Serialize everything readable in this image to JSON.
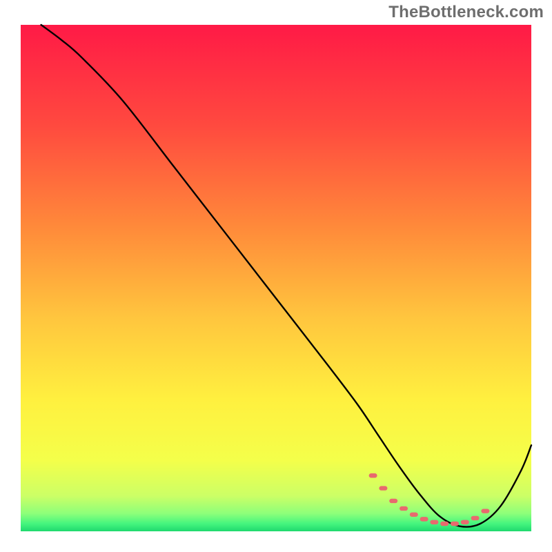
{
  "watermark": "TheBottleneck.com",
  "chart_data": {
    "type": "line",
    "title": "",
    "xlabel": "",
    "ylabel": "",
    "xlim": [
      0,
      100
    ],
    "ylim": [
      0,
      100
    ],
    "grid": false,
    "legend": false,
    "gradient_stops": [
      {
        "offset": 0.0,
        "color": "#ff1a46"
      },
      {
        "offset": 0.2,
        "color": "#ff4a3f"
      },
      {
        "offset": 0.4,
        "color": "#ff8a3a"
      },
      {
        "offset": 0.58,
        "color": "#ffc63e"
      },
      {
        "offset": 0.74,
        "color": "#fff03f"
      },
      {
        "offset": 0.86,
        "color": "#f4ff4a"
      },
      {
        "offset": 0.93,
        "color": "#ccff66"
      },
      {
        "offset": 0.965,
        "color": "#8dff7a"
      },
      {
        "offset": 0.985,
        "color": "#45f57e"
      },
      {
        "offset": 1.0,
        "color": "#1fd96e"
      }
    ],
    "series": [
      {
        "name": "bottleneck-curve",
        "color": "#000000",
        "x": [
          4,
          8,
          12,
          20,
          30,
          40,
          50,
          60,
          66,
          70,
          74,
          78,
          82,
          86,
          90,
          94,
          98,
          100
        ],
        "values": [
          100,
          97,
          93.5,
          85,
          72,
          59,
          46,
          33,
          25,
          19,
          13,
          7.5,
          3,
          1,
          1.5,
          5,
          12,
          17
        ]
      },
      {
        "name": "optimal-zone-marker",
        "color": "#e86a6e",
        "style": "dotted",
        "x": [
          69,
          71,
          73,
          75,
          77,
          79,
          81,
          83,
          85,
          87,
          89,
          91
        ],
        "values": [
          11,
          8.5,
          6,
          4.5,
          3.3,
          2.4,
          1.8,
          1.5,
          1.5,
          1.8,
          2.6,
          4
        ]
      }
    ],
    "annotations": []
  }
}
